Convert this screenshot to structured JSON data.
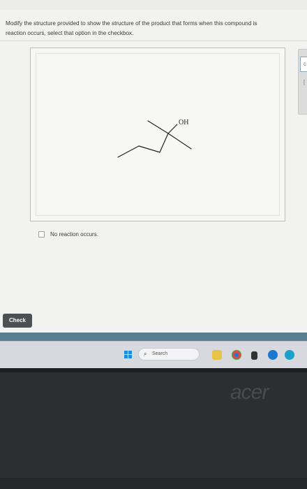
{
  "question": {
    "line1": "Modify the structure provided to show the structure of the product that forms when this compound is",
    "line2": "reaction occurs, select that option in the checkbox."
  },
  "molecule": {
    "atom_label": "OH"
  },
  "side_panel": {
    "button_glyph": "c",
    "mark": "["
  },
  "checkbox": {
    "label": "No reaction occurs.",
    "checked": false
  },
  "check_button": {
    "label": "Check"
  },
  "taskbar": {
    "search_placeholder": "Search"
  },
  "laptop": {
    "brand": "acer"
  },
  "colors": {
    "check_button": "#4d5052",
    "bottom_bar": "#597e8e",
    "taskbar": "#d8d9de",
    "windows_logo": "#1f8be0",
    "checkbox_border": "#8aa0b5"
  }
}
